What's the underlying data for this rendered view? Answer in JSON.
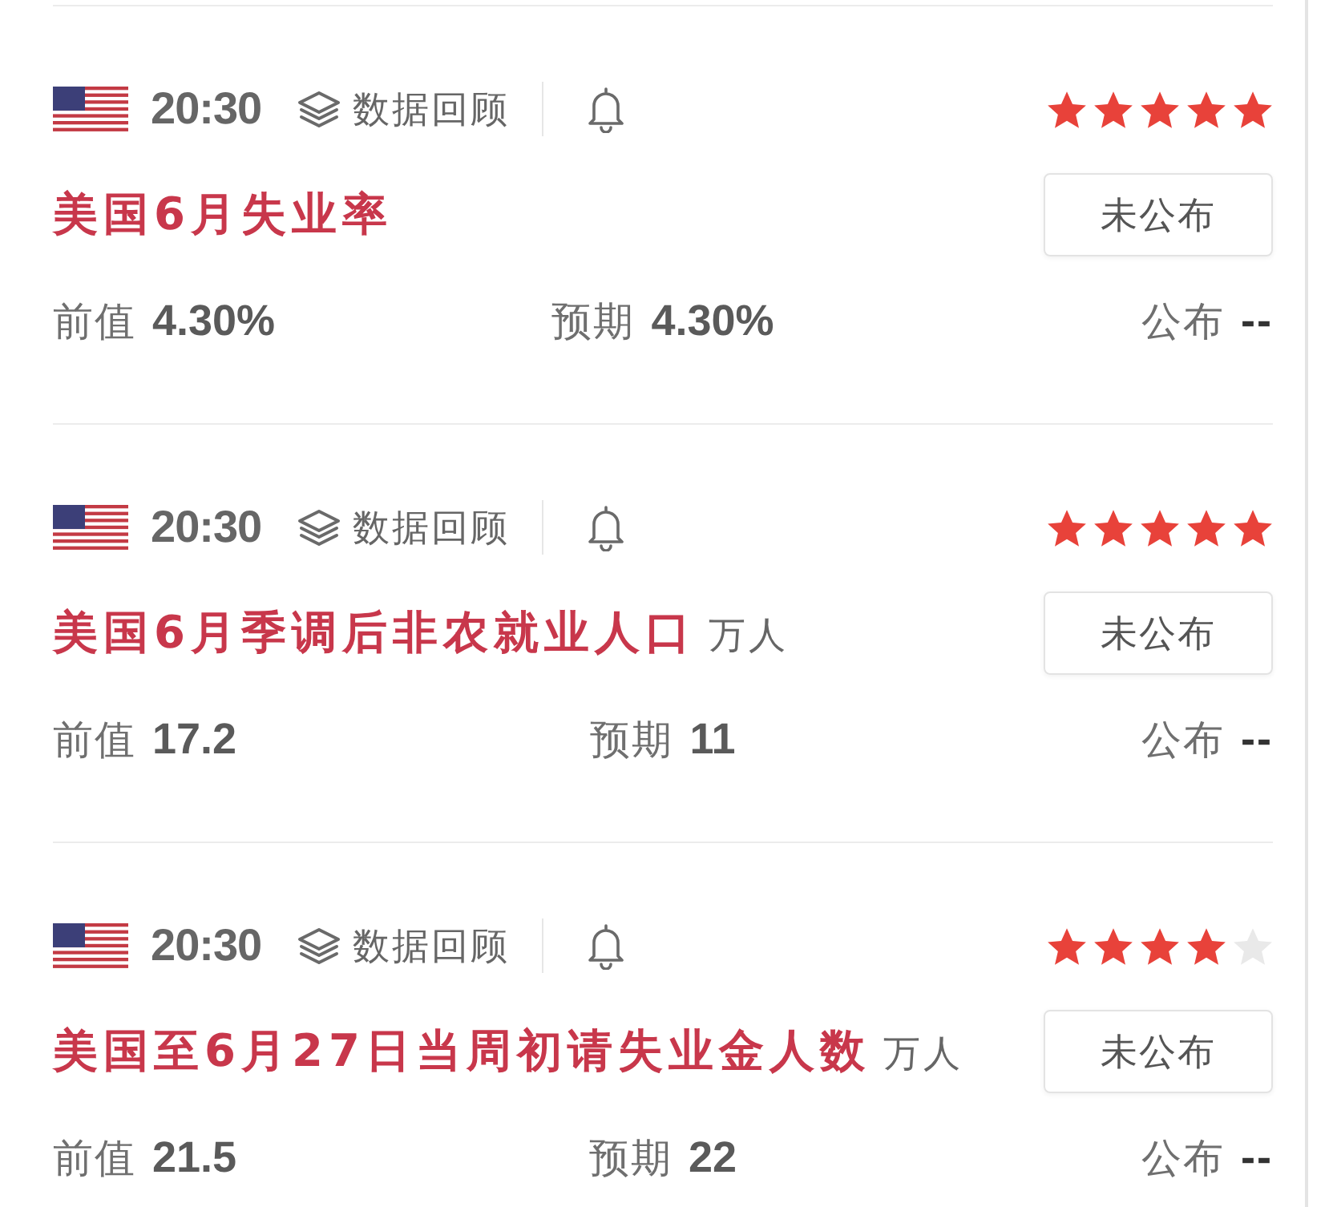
{
  "events": [
    {
      "time": "20:30",
      "review_label": "数据回顾",
      "stars": 5,
      "title": "美国6月失业率",
      "status": "未公布",
      "previous_label": "前值",
      "previous": "4.30%",
      "forecast_label": "预期",
      "forecast": "4.30%",
      "actual_label": "公布",
      "actual": "--"
    },
    {
      "time": "20:30",
      "review_label": "数据回顾",
      "stars": 5,
      "title": "美国6月季调后非农就业人口",
      "unit": "万人",
      "status": "未公布",
      "previous_label": "前值",
      "previous": "17.2",
      "forecast_label": "预期",
      "forecast": "11",
      "actual_label": "公布",
      "actual": "--"
    },
    {
      "time": "20:30",
      "review_label": "数据回顾",
      "stars": 4,
      "title": "美国至6月27日当周初请失业金人数",
      "unit": "万人",
      "status": "未公布",
      "previous_label": "前值",
      "previous": "21.5",
      "forecast_label": "预期",
      "forecast": "22",
      "actual_label": "公布",
      "actual": "--"
    }
  ]
}
